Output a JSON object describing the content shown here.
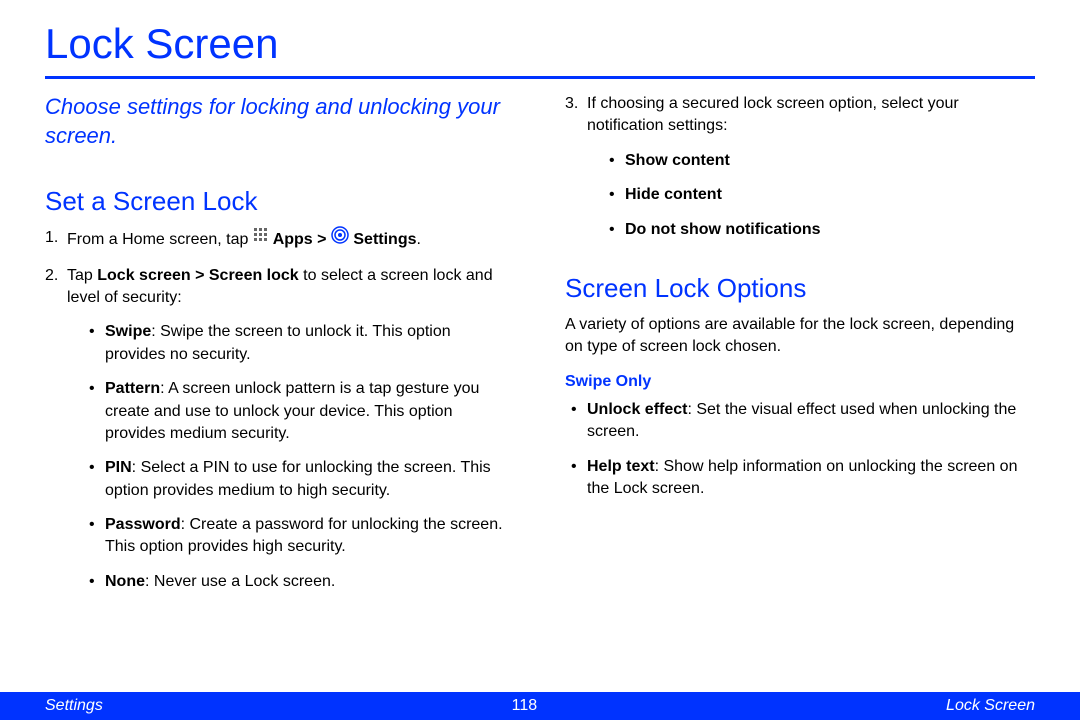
{
  "title": "Lock Screen",
  "intro": "Choose settings for locking and unlocking your screen.",
  "section1": {
    "heading": "Set a Screen Lock",
    "step1_num": "1.",
    "step1_a": "From a Home screen, tap ",
    "step1_apps": " Apps > ",
    "step1_settings": " Settings",
    "step1_end": ".",
    "step2_num": "2.",
    "step2_a": "Tap ",
    "step2_b": "Lock screen > Screen lock",
    "step2_c": " to select a screen lock and level of security:",
    "bullets": {
      "swipe_b": "Swipe",
      "swipe_t": ": Swipe the screen to unlock it. This option provides no security.",
      "pattern_b": "Pattern",
      "pattern_t": ": A screen unlock pattern is a tap gesture you create and use to unlock your device. This option provides medium security.",
      "pin_b": "PIN",
      "pin_t": ": Select a PIN to use for unlocking the screen. This option provides medium to high security.",
      "password_b": "Password",
      "password_t": ": Create a password for unlocking the screen. This option provides high security.",
      "none_b": "None",
      "none_t": ": Never use a Lock screen."
    }
  },
  "step3": {
    "num": "3.",
    "text": "If choosing a secured lock screen option, select your notification settings:",
    "b1": "Show content",
    "b2": "Hide content",
    "b3": "Do not show notifications"
  },
  "section2": {
    "heading": "Screen Lock Options",
    "para": "A variety of options are available for the lock screen, depending on type of screen lock chosen.",
    "sub": "Swipe Only",
    "unlock_b": "Unlock effect",
    "unlock_t": ": Set the visual effect used when unlocking the screen.",
    "help_b": "Help text",
    "help_t": ": Show help information on unlocking the screen on the Lock screen."
  },
  "footer": {
    "left": "Settings",
    "center": "118",
    "right": "Lock Screen"
  }
}
